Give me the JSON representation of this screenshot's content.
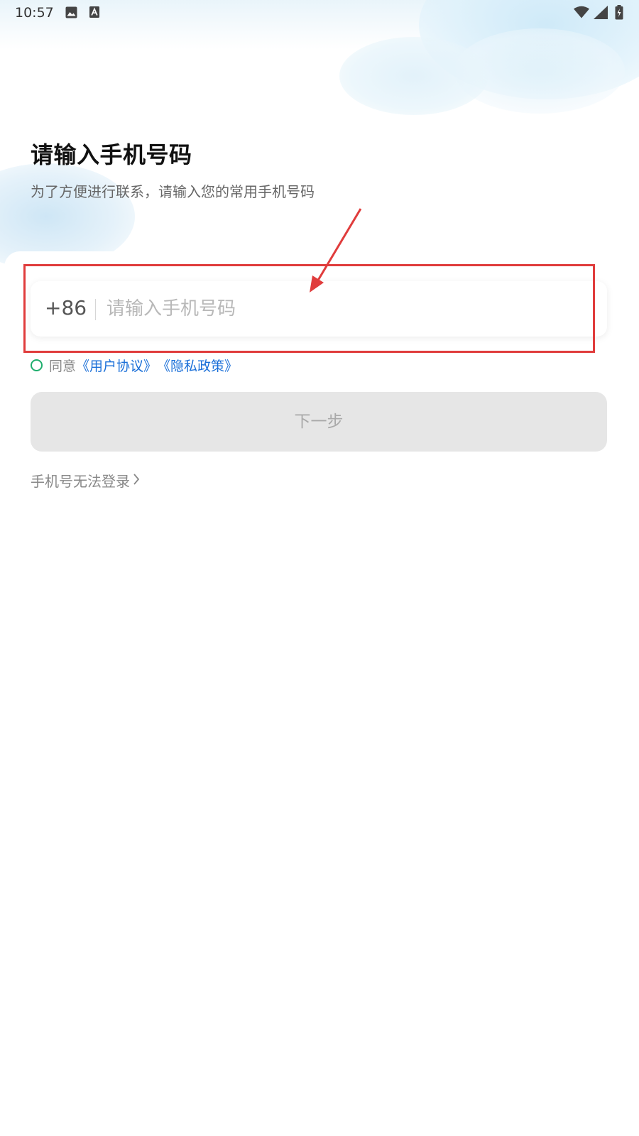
{
  "status_bar": {
    "time": "10:57",
    "icons": [
      "image-icon",
      "a-icon",
      "wifi-icon",
      "signal-icon",
      "battery-charging-icon"
    ]
  },
  "header": {
    "title": "请输入手机号码",
    "subtitle": "为了方便进行联系，请输入您的常用手机号码"
  },
  "phone_input": {
    "country_code": "+86",
    "placeholder": "请输入手机号码",
    "value": ""
  },
  "agreement": {
    "prefix": "同意",
    "user_agreement": "《用户协议》",
    "privacy_policy": "《隐私政策》",
    "checked": false
  },
  "actions": {
    "next_label": "下一步",
    "cannot_login_label": "手机号无法登录"
  },
  "colors": {
    "annotation": "#e03c3c",
    "link": "#1a6fd8",
    "radio": "#1fae6e",
    "button_disabled_bg": "#e6e6e6",
    "button_disabled_text": "#a9a9a9"
  }
}
